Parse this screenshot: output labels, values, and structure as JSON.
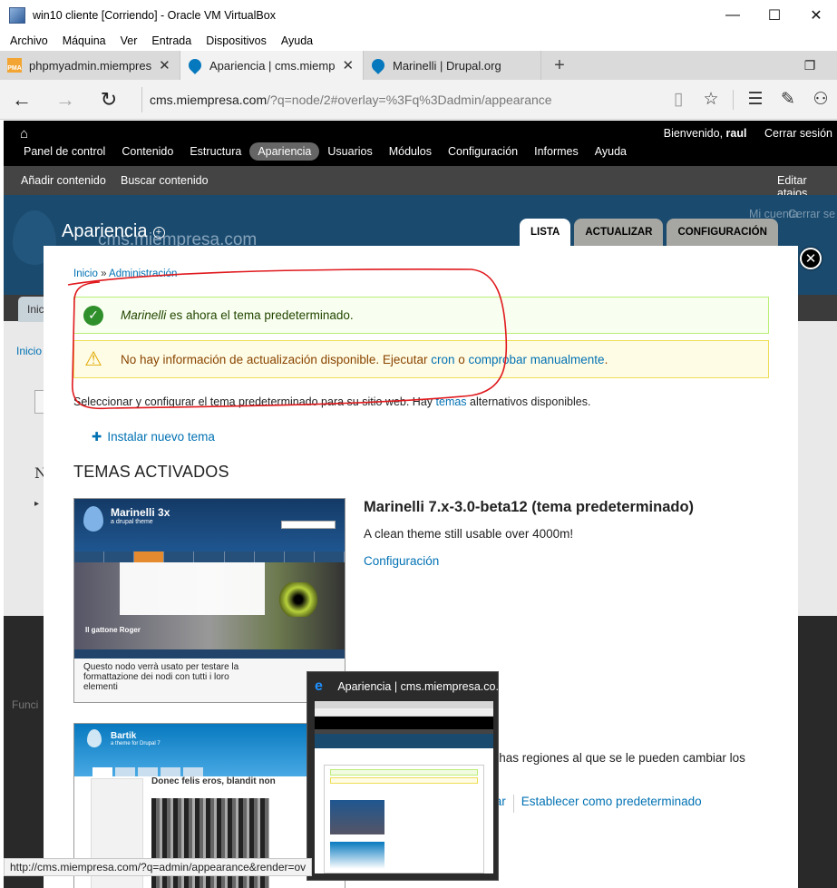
{
  "vbox": {
    "title": "win10 cliente [Corriendo] - Oracle VM VirtualBox",
    "menu": [
      "Archivo",
      "Máquina",
      "Ver",
      "Entrada",
      "Dispositivos",
      "Ayuda"
    ],
    "minimize": "—",
    "maximize": "☐",
    "close": "✕"
  },
  "browser": {
    "tabs": [
      {
        "label": "phpmyadmin.miempres",
        "favicon_text": "PMA"
      },
      {
        "label": "Apariencia | cms.miemp"
      },
      {
        "label": "Marinelli | Drupal.org"
      }
    ],
    "url_domain": "cms.miempresa.com",
    "url_rest": "/?q=node/2#overlay=%3Fq%3Dadmin/appearance",
    "status_url": "http://cms.miempresa.com/?q=admin/appearance&render=ov"
  },
  "toolbar": {
    "menu": [
      "Panel de control",
      "Contenido",
      "Estructura",
      "Apariencia",
      "Usuarios",
      "Módulos",
      "Configuración",
      "Informes",
      "Ayuda"
    ],
    "welcome": "Bienvenido,",
    "username": "raul",
    "logout": "Cerrar sesión",
    "shortcuts": {
      "add": "Añadir contenido",
      "find": "Buscar contenido",
      "edit": "Editar atajos"
    }
  },
  "background": {
    "site_name": "cms.miempresa.com",
    "my_account": "Mi cuenta",
    "logout_partial": "Cerrar se",
    "fragments": [
      "Inic",
      "Inicio",
      "N",
      "▸",
      "Funci"
    ]
  },
  "overlay": {
    "title": "Apariencia",
    "tabs": [
      "LISTA",
      "ACTUALIZAR",
      "CONFIGURACIÓN"
    ],
    "close_glyph": "✕",
    "breadcrumb": {
      "home": "Inicio",
      "sep": "»",
      "admin": "Administración"
    },
    "status_ok": {
      "theme": "Marinelli",
      "text": " es ahora el tema predeterminado."
    },
    "status_warn": {
      "text": "No hay información de actualización disponible. Ejecutar ",
      "link1": "cron",
      "middle": " o ",
      "link2": "comprobar manualmente",
      "end": "."
    },
    "description": {
      "before": "Seleccionar y configurar el tema predeterminado para su sitio web. Hay ",
      "link": "temas",
      "after": " alternativos disponibles."
    },
    "install_link": "Instalar nuevo tema",
    "section_title": "TEMAS ACTIVADOS",
    "theme1": {
      "name": "Marinelli 7.x-3.0-beta12 (tema predeterminado)",
      "description": "A clean theme still usable over 4000m!",
      "config_link": "Configuración",
      "shot_title": "Marinelli 3x",
      "shot_subtitle": "a drupal theme",
      "shot_caption": "Il gattone Roger",
      "shot_text": "Questo nodo verrà usato per testare la formattazione dei nodi con tutti i loro elementi"
    },
    "theme2": {
      "description_line1": "uchas regiones al que se le pueden cambiar los",
      "disable_partial": "ivar",
      "set_default": "Establecer como predeterminado",
      "shot_title": "Bartik",
      "shot_subtitle": "a theme for Drupal 7",
      "shot_post": "Donec felis eros, blandit non"
    }
  },
  "taskbar_thumb": {
    "icon_glyph": "e",
    "label": "Apariencia | cms.miempresa.co..."
  }
}
